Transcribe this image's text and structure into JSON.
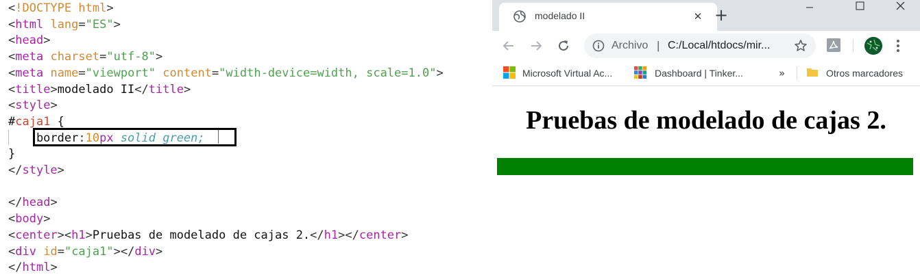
{
  "editor": {
    "lines": [
      [
        {
          "t": "<",
          "c": "c-punc"
        },
        {
          "t": "!DOCTYPE html",
          "c": "c-doctag"
        },
        {
          "t": ">",
          "c": "c-punc"
        }
      ],
      [
        {
          "t": "<",
          "c": "c-punc"
        },
        {
          "t": "html",
          "c": "c-tag"
        },
        {
          "t": " ",
          "c": "c-plain"
        },
        {
          "t": "lang",
          "c": "c-attr"
        },
        {
          "t": "=",
          "c": "c-punc"
        },
        {
          "t": "\"ES\"",
          "c": "c-str"
        },
        {
          "t": ">",
          "c": "c-punc"
        }
      ],
      [
        {
          "t": "<",
          "c": "c-punc"
        },
        {
          "t": "head",
          "c": "c-tag"
        },
        {
          "t": ">",
          "c": "c-punc"
        }
      ],
      [
        {
          "t": "<",
          "c": "c-punc"
        },
        {
          "t": "meta",
          "c": "c-tag"
        },
        {
          "t": " ",
          "c": "c-plain"
        },
        {
          "t": "charset",
          "c": "c-attr"
        },
        {
          "t": "=",
          "c": "c-punc"
        },
        {
          "t": "\"utf-8\"",
          "c": "c-str"
        },
        {
          "t": ">",
          "c": "c-punc"
        }
      ],
      [
        {
          "t": "<",
          "c": "c-punc"
        },
        {
          "t": "meta",
          "c": "c-tag"
        },
        {
          "t": " ",
          "c": "c-plain"
        },
        {
          "t": "name",
          "c": "c-attr"
        },
        {
          "t": "=",
          "c": "c-punc"
        },
        {
          "t": "\"viewport\"",
          "c": "c-str"
        },
        {
          "t": " ",
          "c": "c-plain"
        },
        {
          "t": "content",
          "c": "c-attr"
        },
        {
          "t": "=",
          "c": "c-punc"
        },
        {
          "t": "\"width-device=width, scale=1.0\"",
          "c": "c-str"
        },
        {
          "t": ">",
          "c": "c-punc"
        }
      ],
      [
        {
          "t": "<",
          "c": "c-punc"
        },
        {
          "t": "title",
          "c": "c-tag"
        },
        {
          "t": ">",
          "c": "c-punc"
        },
        {
          "t": "modelado II",
          "c": "c-plain"
        },
        {
          "t": "</",
          "c": "c-punc"
        },
        {
          "t": "title",
          "c": "c-tag"
        },
        {
          "t": ">",
          "c": "c-punc"
        }
      ],
      [
        {
          "t": "<",
          "c": "c-punc"
        },
        {
          "t": "style",
          "c": "c-tag"
        },
        {
          "t": ">",
          "c": "c-punc"
        }
      ],
      [
        {
          "t": "#",
          "c": "c-plain"
        },
        {
          "t": "caja1",
          "c": "c-id"
        },
        {
          "t": " {",
          "c": "c-plain"
        }
      ],
      [
        {
          "t": "    border",
          "c": "c-plain"
        },
        {
          "t": ":",
          "c": "c-punc"
        },
        {
          "t": "10",
          "c": "c-num"
        },
        {
          "t": "px",
          "c": "c-unit"
        },
        {
          "t": " solid green;",
          "c": "c-it"
        }
      ],
      [
        {
          "t": "}",
          "c": "c-plain"
        }
      ],
      [
        {
          "t": "</",
          "c": "c-punc"
        },
        {
          "t": "style",
          "c": "c-tag"
        },
        {
          "t": ">",
          "c": "c-punc"
        }
      ],
      [],
      [
        {
          "t": "</",
          "c": "c-punc"
        },
        {
          "t": "head",
          "c": "c-tag"
        },
        {
          "t": ">",
          "c": "c-punc"
        }
      ],
      [
        {
          "t": "<",
          "c": "c-punc"
        },
        {
          "t": "body",
          "c": "c-tag"
        },
        {
          "t": ">",
          "c": "c-punc"
        }
      ],
      [
        {
          "t": "<",
          "c": "c-punc"
        },
        {
          "t": "center",
          "c": "c-tag"
        },
        {
          "t": "><",
          "c": "c-punc"
        },
        {
          "t": "h1",
          "c": "c-tag"
        },
        {
          "t": ">",
          "c": "c-punc"
        },
        {
          "t": "Pruebas de modelado de cajas 2.",
          "c": "c-plain"
        },
        {
          "t": "</",
          "c": "c-punc"
        },
        {
          "t": "h1",
          "c": "c-tag"
        },
        {
          "t": "></",
          "c": "c-punc"
        },
        {
          "t": "center",
          "c": "c-tag"
        },
        {
          "t": ">",
          "c": "c-punc"
        }
      ],
      [
        {
          "t": "<",
          "c": "c-punc"
        },
        {
          "t": "div",
          "c": "c-tag"
        },
        {
          "t": " ",
          "c": "c-plain"
        },
        {
          "t": "id",
          "c": "c-attr"
        },
        {
          "t": "=",
          "c": "c-punc"
        },
        {
          "t": "\"caja1\"",
          "c": "c-str"
        },
        {
          "t": "></",
          "c": "c-punc"
        },
        {
          "t": "div",
          "c": "c-tag"
        },
        {
          "t": ">",
          "c": "c-punc"
        }
      ],
      [
        {
          "t": "</",
          "c": "c-punc"
        },
        {
          "t": "html",
          "c": "c-tag"
        },
        {
          "t": ">",
          "c": "c-punc"
        }
      ]
    ]
  },
  "browser": {
    "tab": {
      "title": "modelado II",
      "close_glyph": "✕"
    },
    "newtab_glyph": "+",
    "omnibox": {
      "scheme": "Archivo",
      "separator": "|",
      "url": "C:/Local/htdocs/mir..."
    },
    "bookmarks": [
      {
        "label": "Microsoft Virtual Ac...",
        "icon": "microsoft-logo-icon"
      },
      {
        "label": "Dashboard | Tinker...",
        "icon": "tinkercad-logo-icon"
      }
    ],
    "bookmarks_more": "»",
    "other_bookmarks": "Otros marcadores"
  },
  "page": {
    "heading": "Pruebas de modelado de cajas 2.",
    "box_color": "#008000"
  }
}
